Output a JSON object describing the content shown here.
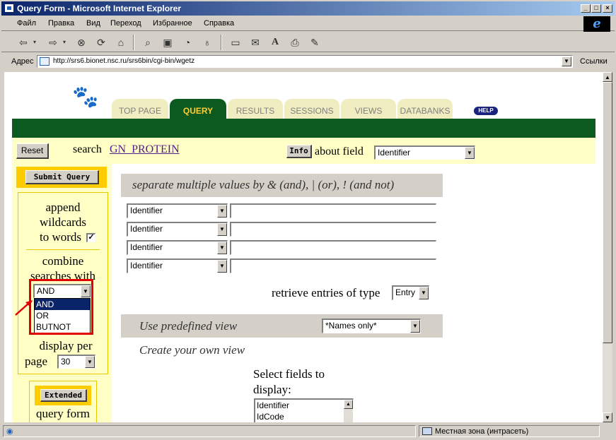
{
  "window": {
    "title": "Query Form - Microsoft Internet Explorer"
  },
  "menu": [
    "Файл",
    "Правка",
    "Вид",
    "Переход",
    "Избранное",
    "Справка"
  ],
  "toolbar_icons": [
    "back-icon",
    "forward-icon",
    "stop-icon",
    "refresh-icon",
    "home-icon",
    "search-icon",
    "favorites-icon",
    "history-icon",
    "channels-icon",
    "fullscreen-icon",
    "mail-icon",
    "font-icon",
    "print-icon",
    "edit-icon"
  ],
  "address": {
    "label": "Адрес",
    "url": "http://srs6.bionet.nsc.ru/srs6bin/cgi-bin/wgetz",
    "links_label": "Ссылки"
  },
  "tabs": [
    {
      "label": "TOP PAGE",
      "active": false
    },
    {
      "label": "QUERY",
      "active": true
    },
    {
      "label": "RESULTS",
      "active": false
    },
    {
      "label": "SESSIONS",
      "active": false
    },
    {
      "label": "VIEWS",
      "active": false
    },
    {
      "label": "DATABANKS",
      "active": false
    }
  ],
  "help_label": "HELP",
  "header": {
    "reset_label": "Reset",
    "search_label": "search",
    "library_link": "GN_PROTEIN",
    "info_label": "Info",
    "about_field_label": "about field",
    "about_field_value": "Identifier"
  },
  "sidebar": {
    "submit_label": "Submit Query",
    "wildcards_line1": "append",
    "wildcards_line2": "wildcards",
    "wildcards_line3": "to words",
    "wildcards_checked": "✓",
    "combine_line1": "combine",
    "combine_line2": "searches with",
    "combine_value": "AND",
    "combine_options": [
      "AND",
      "OR",
      "BUTNOT"
    ],
    "display_per_label": "display per",
    "page_label": "page",
    "page_value": "30",
    "extended_label": "Extended",
    "query_form_label": "query form"
  },
  "query": {
    "hint": "separate multiple values by & (and), | (or), ! (and not)",
    "rows": [
      {
        "field": "Identifier",
        "value": ""
      },
      {
        "field": "Identifier",
        "value": ""
      },
      {
        "field": "Identifier",
        "value": ""
      },
      {
        "field": "Identifier",
        "value": ""
      }
    ],
    "retrieve_label": "retrieve entries of type",
    "retrieve_value": "Entry"
  },
  "view": {
    "predefined_label": "Use predefined view",
    "predefined_value": "*Names only*",
    "own_view_label": "Create your own view",
    "select_fields_line1": "Select fields to",
    "select_fields_line2": "display:",
    "fields": [
      "Identifier",
      "IdCode"
    ]
  },
  "status": {
    "zone": "Местная зона (интрасеть)"
  },
  "colors": {
    "tab_green": "#0d5a20",
    "panel_yellow": "#ffffc6",
    "highlight_red": "#e00000",
    "title_blue": "#0a246a"
  }
}
